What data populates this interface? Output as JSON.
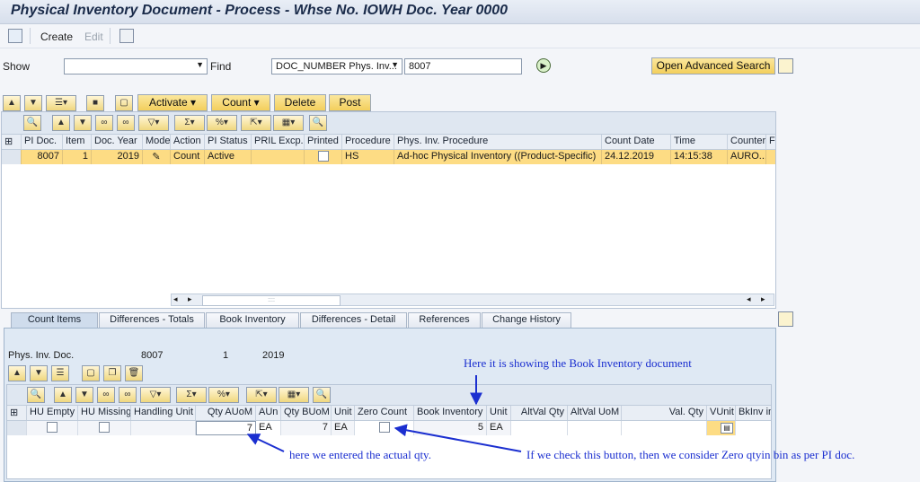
{
  "window": {
    "title": "Physical Inventory Document - Process - Whse No. IOWH Doc. Year 0000"
  },
  "app_toolbar": {
    "create_label": "Create",
    "edit_label": "Edit"
  },
  "find_bar": {
    "show_label": "Show",
    "show_value": "",
    "find_label": "Find",
    "field_select": "DOC_NUMBER Phys. Inv...",
    "find_value": "8007",
    "advanced_search_label": "Open Advanced Search"
  },
  "action_toolbar": {
    "activate": "Activate",
    "count": "Count",
    "delete": "Delete",
    "post": "Post"
  },
  "upper_table": {
    "columns": [
      "PI Doc.",
      "Item",
      "Doc. Year",
      "Mode",
      "Action",
      "PI Status",
      "PRIL Excp.",
      "Printed",
      "Procedure",
      "Phys. Inv. Procedure",
      "Count Date",
      "Time",
      "Counter",
      "F"
    ],
    "rows": [
      {
        "pi_doc": "8007",
        "item": "1",
        "doc_year": "2019",
        "mode": "✎",
        "action": "Count",
        "pi_status": "Active",
        "pril_excp": "",
        "printed": "",
        "procedure": "HS",
        "phys_inv_procedure": "Ad-hoc Physical Inventory ((Product-Specific)",
        "count_date": "24.12.2019",
        "time": "14:15:38",
        "counter": "AURO..."
      }
    ],
    "scroll_mark": "::::"
  },
  "tabs": [
    "Count Items",
    "Differences - Totals",
    "Book Inventory",
    "Differences - Detail",
    "References",
    "Change History"
  ],
  "detail_header": {
    "label": "Phys. Inv. Doc.",
    "doc": "8007",
    "item": "1",
    "year": "2019"
  },
  "lower_table": {
    "columns": [
      "HU Empty",
      "HU Missing",
      "Handling Unit",
      "Qty AUoM",
      "AUn",
      "Qty BUoM",
      "Unit",
      "Zero Count",
      "Book Inventory",
      "Unit",
      "AltVal Qty",
      "AltVal UoM",
      "Val. Qty",
      "VUnit",
      "BkInv in"
    ],
    "rows": [
      {
        "qty_auom": "7",
        "aun": "EA",
        "qty_buom": "7",
        "unit": "EA",
        "book_inventory": "5",
        "unit2": "EA"
      }
    ]
  },
  "annotations": {
    "book_inventory_note": "Here it is showing the Book Inventory document",
    "actual_qty_note": "here we entered the actual qty.",
    "zero_count_note": "If we check this button, then we consider Zero qtyin bin as per PI doc."
  }
}
